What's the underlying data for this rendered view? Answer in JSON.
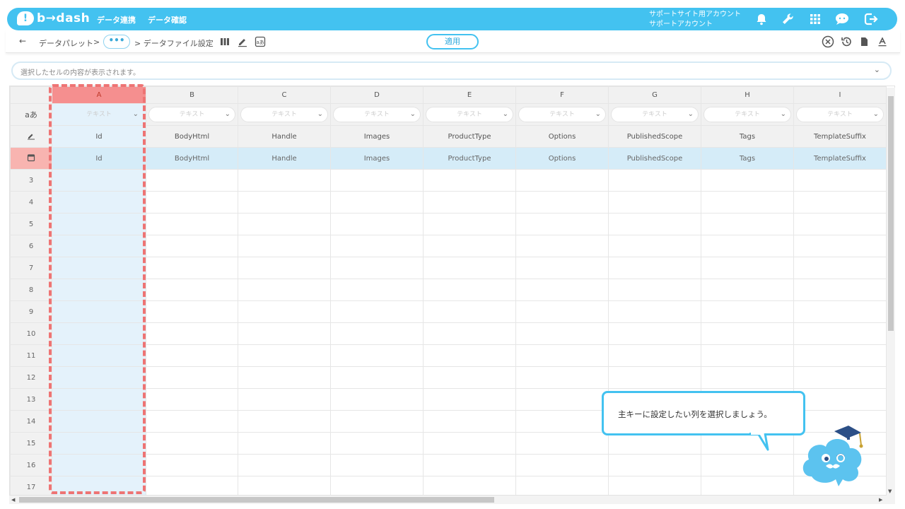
{
  "header": {
    "logo_mark": "!",
    "logo_text": "b→dash",
    "nav": [
      "データ連携",
      "データ確認"
    ],
    "account_line1": "サポートサイト用アカウント",
    "account_line2": "サポートアカウント",
    "icons": [
      "bell-icon",
      "wrench-icon",
      "grid-icon",
      "chat-icon",
      "logout-icon"
    ]
  },
  "toolbar": {
    "back": "←",
    "crumb1": "データパレット",
    "sep": ">",
    "dots": "•••",
    "crumb2": "> データファイル設定",
    "apply_label": "適用",
    "left_icons": [
      "columns-icon",
      "edit-icon",
      "text-type-icon"
    ],
    "right_icons": [
      "close-circle-icon",
      "history-icon",
      "document-icon",
      "font-icon"
    ]
  },
  "cellbar": {
    "placeholder": "選択したセルの内容が表示されます。",
    "chevron": "⌄"
  },
  "grid": {
    "columns": [
      "A",
      "B",
      "C",
      "D",
      "E",
      "F",
      "G",
      "H",
      "I"
    ],
    "selected_column": "A",
    "type_label": "テキスト",
    "type_row_label": "aあ",
    "column_names": [
      "Id",
      "BodyHtml",
      "Handle",
      "Images",
      "ProductType",
      "Options",
      "PublishedScope",
      "Tags",
      "TemplateSuffix"
    ],
    "key_row_values": [
      "Id",
      "BodyHtml",
      "Handle",
      "Images",
      "ProductType",
      "Options",
      "PublishedScope",
      "Tags",
      "TemplateSuffix"
    ],
    "row_numbers": [
      "3",
      "4",
      "5",
      "6",
      "7",
      "8",
      "9",
      "10",
      "11",
      "12",
      "13",
      "14",
      "15",
      "16",
      "17"
    ]
  },
  "tooltip": {
    "text": "主キーに設定したい列を選択しましょう。"
  },
  "colors": {
    "accent": "#43c2f0",
    "selected_header": "#f58f8f",
    "selected_column": "#e4f2fb",
    "dash_border": "#ee7474",
    "key_row": "#d5ecf8"
  }
}
